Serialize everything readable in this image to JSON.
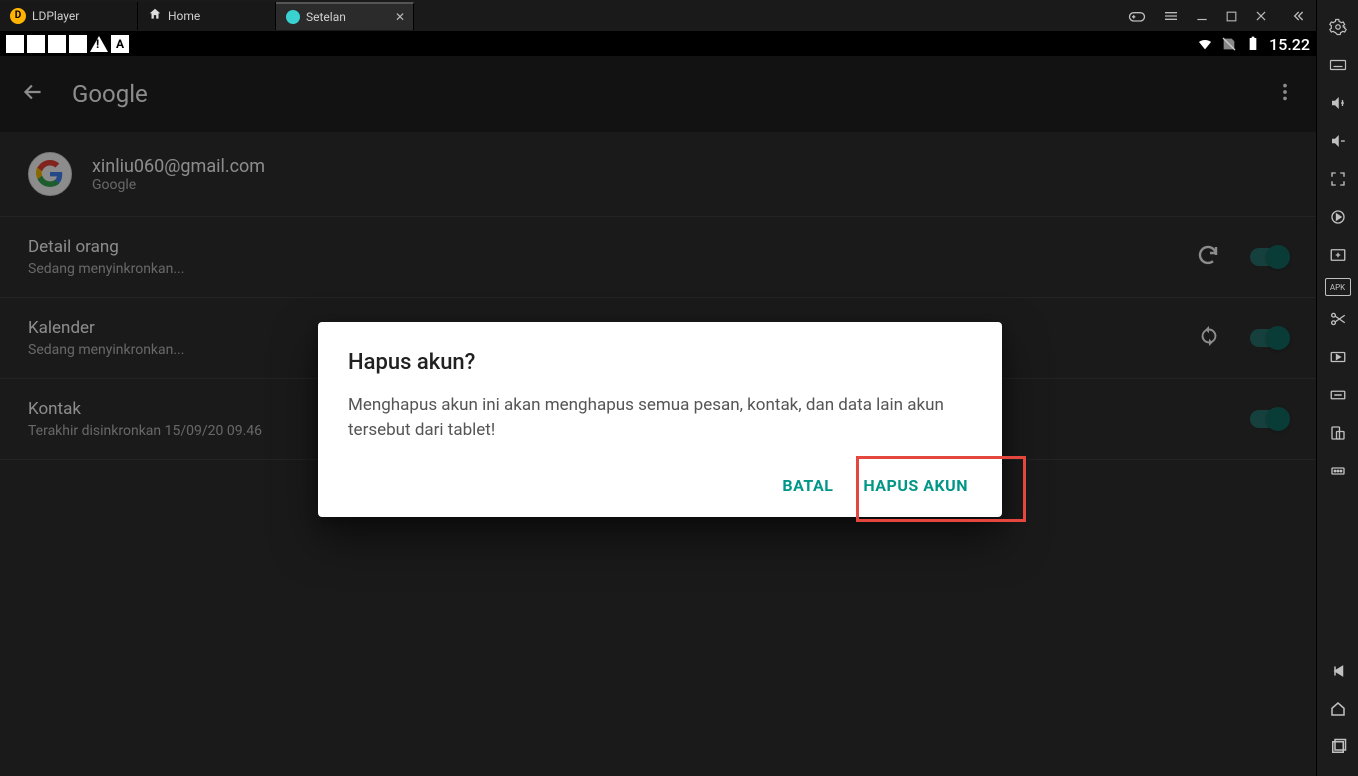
{
  "window": {
    "app_name": "LDPlayer",
    "tabs": [
      {
        "label": "Home"
      },
      {
        "label": "Setelan",
        "active": true
      }
    ]
  },
  "status_bar": {
    "time": "15.22"
  },
  "settings": {
    "title": "Google",
    "account": {
      "email": "xinliu060@gmail.com",
      "provider": "Google"
    },
    "items": [
      {
        "title": "Detail orang",
        "sub": "Sedang menyinkronkan...",
        "icon": "sync-progress"
      },
      {
        "title": "Kalender",
        "sub": "Sedang menyinkronkan...",
        "icon": "sync"
      },
      {
        "title": "Kontak",
        "sub": "Terakhir disinkronkan 15/09/20 09.46",
        "icon": "none"
      }
    ]
  },
  "dialog": {
    "title": "Hapus akun?",
    "body": "Menghapus akun ini akan menghapus semua pesan, kontak, dan data lain akun tersebut dari tablet!",
    "cancel": "BATAL",
    "confirm": "HAPUS AKUN"
  }
}
